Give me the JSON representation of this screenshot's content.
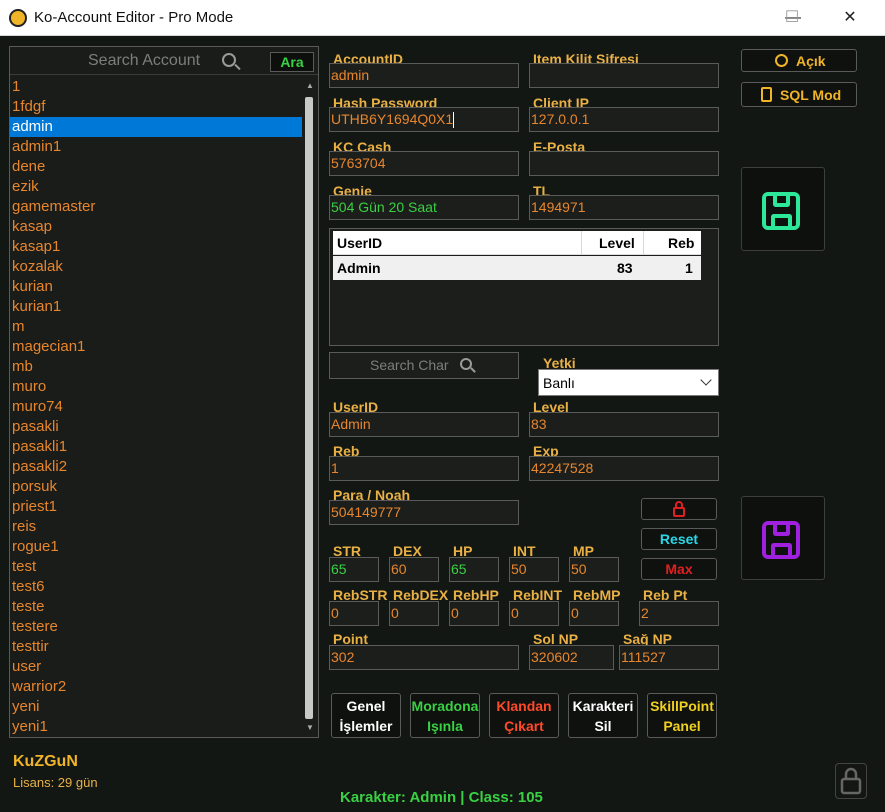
{
  "window": {
    "title": "Ko-Account Editor - Pro Mode",
    "controls": {
      "minimize": "—",
      "maximize": "☐",
      "close": "✕"
    }
  },
  "accounts": {
    "search_placeholder": "Search Account",
    "search_button": "Ara",
    "selected": "admin",
    "items": [
      "1",
      "1fdgf",
      "admin",
      "admin1",
      "dene",
      "ezik",
      "gamemaster",
      "kasap",
      "kasap1",
      "kozalak",
      "kurian",
      "kurian1",
      "m",
      "magecian1",
      "mb",
      "muro",
      "muro74",
      "pasakli",
      "pasakli1",
      "pasakli2",
      "porsuk",
      "priest1",
      "reis",
      "rogue1",
      "test",
      "test6",
      "teste",
      "testere",
      "testtir",
      "user",
      "warrior2",
      "yeni",
      "yeni1"
    ]
  },
  "account_form": {
    "account_id": {
      "label": "AccountID",
      "value": "admin"
    },
    "item_lock": {
      "label": "Item Kilit Şifresi",
      "value": ""
    },
    "hash_password": {
      "label": "Hash Password",
      "value": "UTHB6Y1694Q0X1"
    },
    "client_ip": {
      "label": "Client IP",
      "value": "127.0.0.1"
    },
    "kc_cash": {
      "label": "KC Cash",
      "value": "5763704"
    },
    "email": {
      "label": "E-Posta",
      "value": ""
    },
    "genie": {
      "label": "Genie",
      "value": "504 Gün 20 Saat"
    },
    "tl": {
      "label": "TL",
      "value": "1494971"
    }
  },
  "characters_table": {
    "headers": {
      "user_id": "UserID",
      "level": "Level",
      "reb": "Reb"
    },
    "rows": [
      {
        "user_id": "Admin",
        "level": "83",
        "reb": "1"
      }
    ]
  },
  "char_search_placeholder": "Search Char",
  "yetki": {
    "label": "Yetki",
    "value": "Banlı"
  },
  "char_form": {
    "user_id": {
      "label": "UserID",
      "value": "Admin"
    },
    "level": {
      "label": "Level",
      "value": "83"
    },
    "reb": {
      "label": "Reb",
      "value": "1"
    },
    "exp": {
      "label": "Exp",
      "value": "42247528"
    },
    "money": {
      "label": "Para / Noah",
      "value": "504149777"
    }
  },
  "stats": {
    "str": {
      "label": "STR",
      "value": "65"
    },
    "dex": {
      "label": "DEX",
      "value": "60"
    },
    "hp": {
      "label": "HP",
      "value": "65"
    },
    "int": {
      "label": "INT",
      "value": "50"
    },
    "mp": {
      "label": "MP",
      "value": "50"
    }
  },
  "reb_stats": {
    "reb_str": {
      "label": "RebSTR",
      "value": "0"
    },
    "reb_dex": {
      "label": "RebDEX",
      "value": "0"
    },
    "reb_hp": {
      "label": "RebHP",
      "value": "0"
    },
    "reb_int": {
      "label": "RebINT",
      "value": "0"
    },
    "reb_mp": {
      "label": "RebMP",
      "value": "0"
    },
    "reb_pt": {
      "label": "Reb Pt",
      "value": "2"
    }
  },
  "points": {
    "point": {
      "label": "Point",
      "value": "302"
    },
    "left_np": {
      "label": "Sol NP",
      "value": "320602"
    },
    "right_np": {
      "label": "Sağ NP",
      "value": "111527"
    }
  },
  "stat_buttons": {
    "reset": "Reset",
    "max": "Max"
  },
  "right_panel": {
    "open_label": "Açık",
    "sql_label": "SQL Mod"
  },
  "actions": [
    {
      "line1": "Genel",
      "line2": "İşlemler"
    },
    {
      "line1": "Moradona",
      "line2": "Işınla"
    },
    {
      "line1": "Klandan",
      "line2": "Çıkart"
    },
    {
      "line1": "Karakteri",
      "line2": "Sil"
    },
    {
      "line1": "SkillPoint",
      "line2": "Panel"
    }
  ],
  "license": {
    "user": "KuZGuN",
    "days": "Lisans: 29 gün"
  },
  "status": "Karakter: Admin | Class: 105",
  "colors": {
    "background": "#131713",
    "label": "#e8b045",
    "value_orange": "#e8862d",
    "value_green": "#39d043",
    "reset_cyan": "#29d8e8",
    "max_red": "#e02020",
    "clan_red": "#ff4a2a",
    "save_green": "#2ee89a",
    "save_purple": "#a020e0",
    "selection": "#0078d7"
  }
}
